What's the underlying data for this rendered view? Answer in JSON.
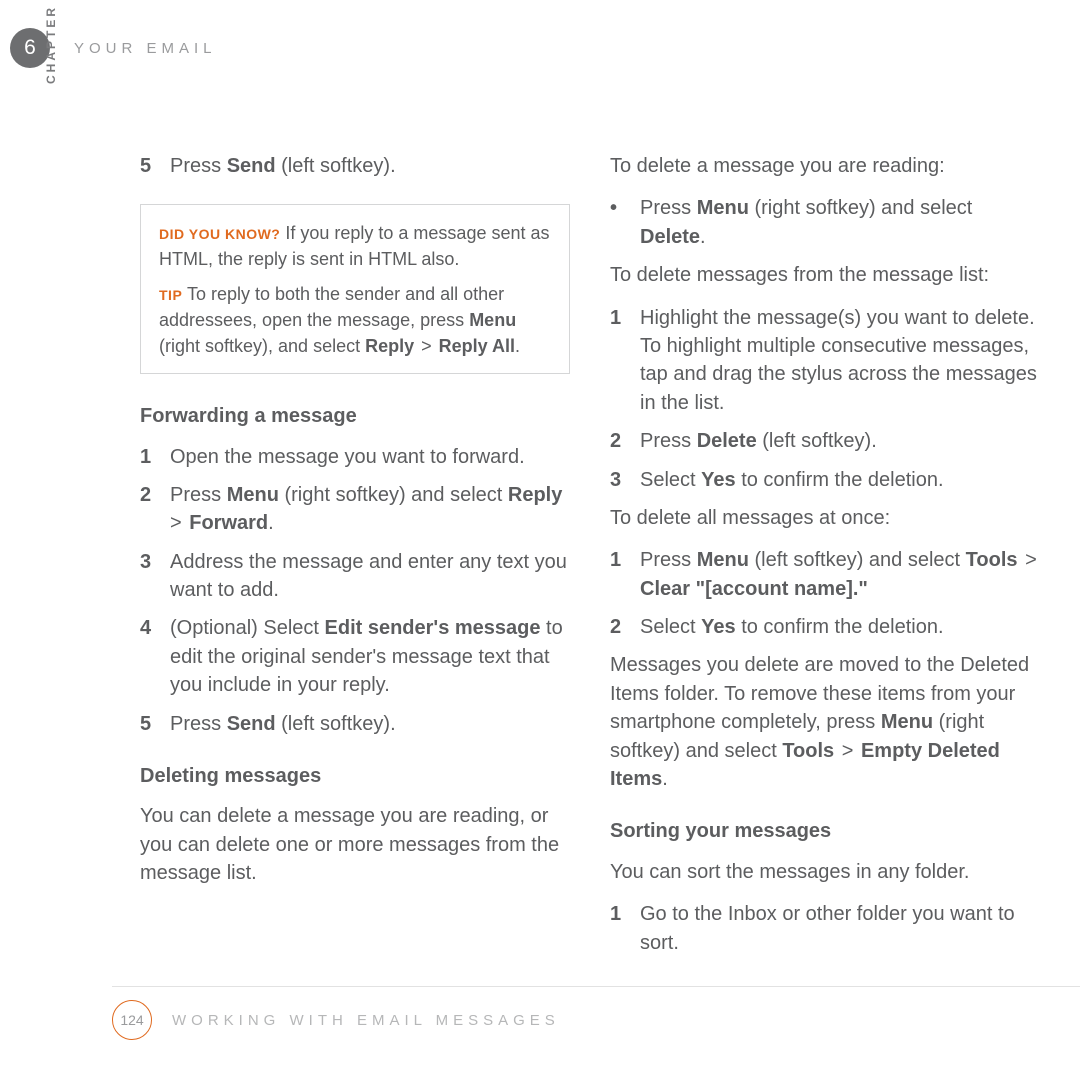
{
  "header": {
    "chapter_number": "6",
    "chapter_title": "YOUR EMAIL",
    "chapter_label": "CHAPTER"
  },
  "left": {
    "step5_n": "5",
    "step5_pre": "Press ",
    "step5_bold": "Send",
    "step5_post": " (left softkey).",
    "callout": {
      "dyk_label": "DID YOU KNOW?",
      "dyk_text": " If you reply to a message sent as HTML, the reply is sent in HTML also.",
      "tip_label": "TIP",
      "tip_pre": " To reply to both the sender and all other addressees, open the message, press ",
      "tip_b1": "Menu",
      "tip_mid": " (right softkey), and select ",
      "tip_b2": "Reply",
      "tip_gt": " > ",
      "tip_b3": "Reply All",
      "tip_end": "."
    },
    "fwd_heading": "Forwarding a message",
    "fwd1_n": "1",
    "fwd1": "Open the message you want to forward.",
    "fwd2_n": "2",
    "fwd2_pre": "Press ",
    "fwd2_b1": "Menu",
    "fwd2_mid": " (right softkey) and select ",
    "fwd2_b2": "Reply",
    "fwd2_gt": " > ",
    "fwd2_b3": "Forward",
    "fwd2_end": ".",
    "fwd3_n": "3",
    "fwd3": "Address the message and enter any text you want to add.",
    "fwd4_n": "4",
    "fwd4_pre": "(Optional) Select ",
    "fwd4_b": "Edit sender's message",
    "fwd4_post": " to edit the original sender's message text that you include in your reply.",
    "fwd5_n": "5",
    "fwd5_pre": "Press ",
    "fwd5_b": "Send",
    "fwd5_post": " (left softkey).",
    "del_heading": "Deleting messages",
    "del_intro": "You can delete a message you are reading, or you can delete one or more messages from the message list."
  },
  "right": {
    "del_reading_intro": "To delete a message you are reading:",
    "bullet_dot": "•",
    "del_reading_pre": "Press ",
    "del_reading_b1": "Menu",
    "del_reading_mid": " (right softkey) and select ",
    "del_reading_b2": "Delete",
    "del_reading_end": ".",
    "del_list_intro": "To delete messages from the message list:",
    "dl1_n": "1",
    "dl1": "Highlight the message(s) you want to delete. To highlight multiple consecutive messages, tap and drag the stylus across the messages in the list.",
    "dl2_n": "2",
    "dl2_pre": "Press ",
    "dl2_b": "Delete",
    "dl2_post": " (left softkey).",
    "dl3_n": "3",
    "dl3_pre": "Select ",
    "dl3_b": "Yes",
    "dl3_post": " to confirm the deletion.",
    "del_all_intro": "To delete all messages at once:",
    "da1_n": "1",
    "da1_pre": "Press ",
    "da1_b1": "Menu",
    "da1_mid": " (left softkey) and select ",
    "da1_b2": "Tools",
    "da1_gt": " > ",
    "da1_b3": "Clear \"[account name].\"",
    "da2_n": "2",
    "da2_pre": "Select ",
    "da2_b": "Yes",
    "da2_post": " to confirm the deletion.",
    "deleted_note_pre": "Messages you delete are moved to the Deleted Items folder. To remove these items from your smartphone completely, press ",
    "deleted_note_b1": "Menu",
    "deleted_note_mid": " (right softkey) and select ",
    "deleted_note_b2": "Tools",
    "deleted_note_gt": " > ",
    "deleted_note_b3": "Empty Deleted Items",
    "deleted_note_end": ".",
    "sort_heading": "Sorting your messages",
    "sort_intro": "You can sort the messages in any folder.",
    "s1_n": "1",
    "s1": "Go to the Inbox or other folder you want to sort."
  },
  "footer": {
    "page_number": "124",
    "footer_title": "WORKING WITH EMAIL MESSAGES"
  }
}
